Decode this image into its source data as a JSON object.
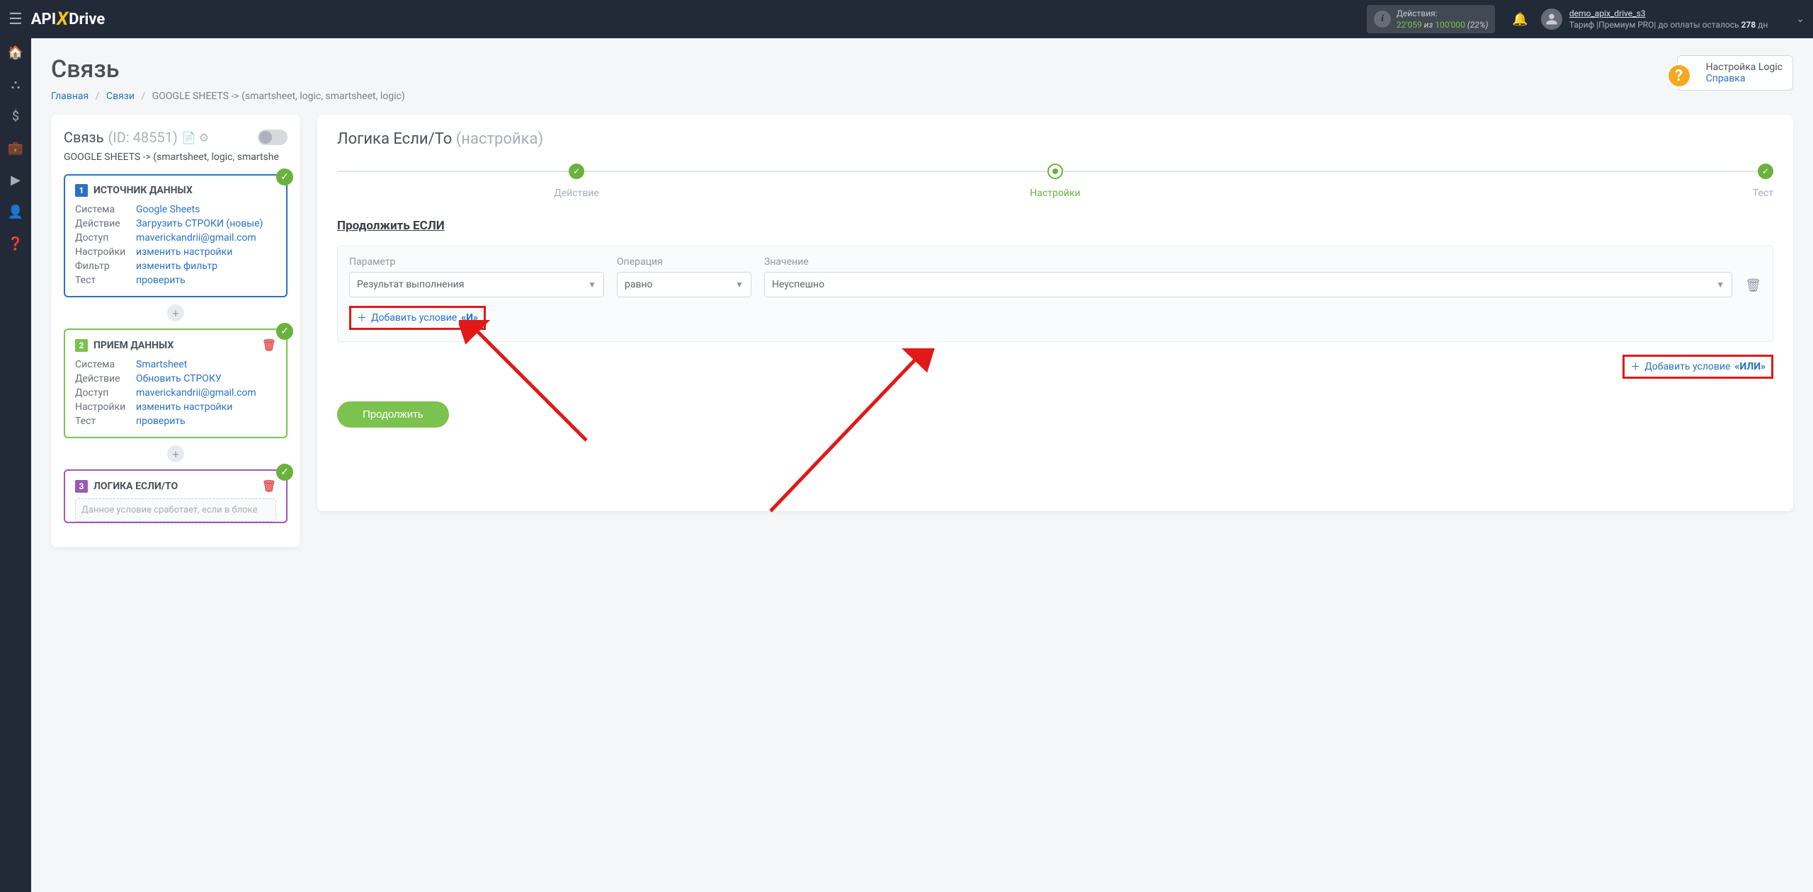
{
  "header": {
    "logo_api": "API",
    "logo_drive": "Drive",
    "actions_label": "Действия:",
    "actions_count": "22'059",
    "actions_sep": " из ",
    "actions_total": "100'000",
    "actions_pct": " (22%)",
    "username": "demo_apix_drive_s3",
    "tariff_prefix": "Тариф |Премиум PRO| до оплаты осталось ",
    "tariff_days": "278",
    "tariff_suffix": " дн"
  },
  "page": {
    "title": "Связь",
    "bc_home": "Главная",
    "bc_links": "Связи",
    "bc_current": "GOOGLE SHEETS -> (smartsheet, logic, smartsheet, logic)",
    "help_line1": "Настройка Logic",
    "help_line2": "Справка"
  },
  "sidebar": {
    "title": "Связь",
    "id_label": "(ID: 48551)",
    "subline": "GOOGLE SHEETS -> (smartsheet, logic, smartshe",
    "card1": {
      "title": "ИСТОЧНИК ДАННЫХ",
      "rows": [
        {
          "k": "Система",
          "v": "Google Sheets"
        },
        {
          "k": "Действие",
          "v": "Загрузить СТРОКИ (новые)"
        },
        {
          "k": "Доступ",
          "v": "maverickandrii@gmail.com"
        },
        {
          "k": "Настройки",
          "v": "изменить настройки"
        },
        {
          "k": "Фильтр",
          "v": "изменить фильтр"
        },
        {
          "k": "Тест",
          "v": "проверить"
        }
      ]
    },
    "card2": {
      "title": "ПРИЕМ ДАННЫХ",
      "rows": [
        {
          "k": "Система",
          "v": "Smartsheet"
        },
        {
          "k": "Действие",
          "v": "Обновить СТРОКУ"
        },
        {
          "k": "Доступ",
          "v": "maverickandrii@gmail.com"
        },
        {
          "k": "Настройки",
          "v": "изменить настройки"
        },
        {
          "k": "Тест",
          "v": "проверить"
        }
      ]
    },
    "card3": {
      "title": "ЛОГИКА ЕСЛИ/ТО",
      "desc": "Данное условие сработает, если в блоке"
    }
  },
  "main": {
    "title_main": "Логика Если/То ",
    "title_sub": "(настройка)",
    "step1": "Действие",
    "step2": "Настройки",
    "step3": "Тест",
    "section": "Продолжить ЕСЛИ",
    "col_param": "Параметр",
    "col_oper": "Операция",
    "col_value": "Значение",
    "param_value": "Результат выполнения",
    "oper_value": "равно",
    "value_value": "Неуспешно",
    "add_and_prefix": "Добавить условие ",
    "add_and_bold": "«И»",
    "add_or_prefix": "Добавить условие ",
    "add_or_bold": "«ИЛИ»",
    "continue": "Продолжить"
  }
}
